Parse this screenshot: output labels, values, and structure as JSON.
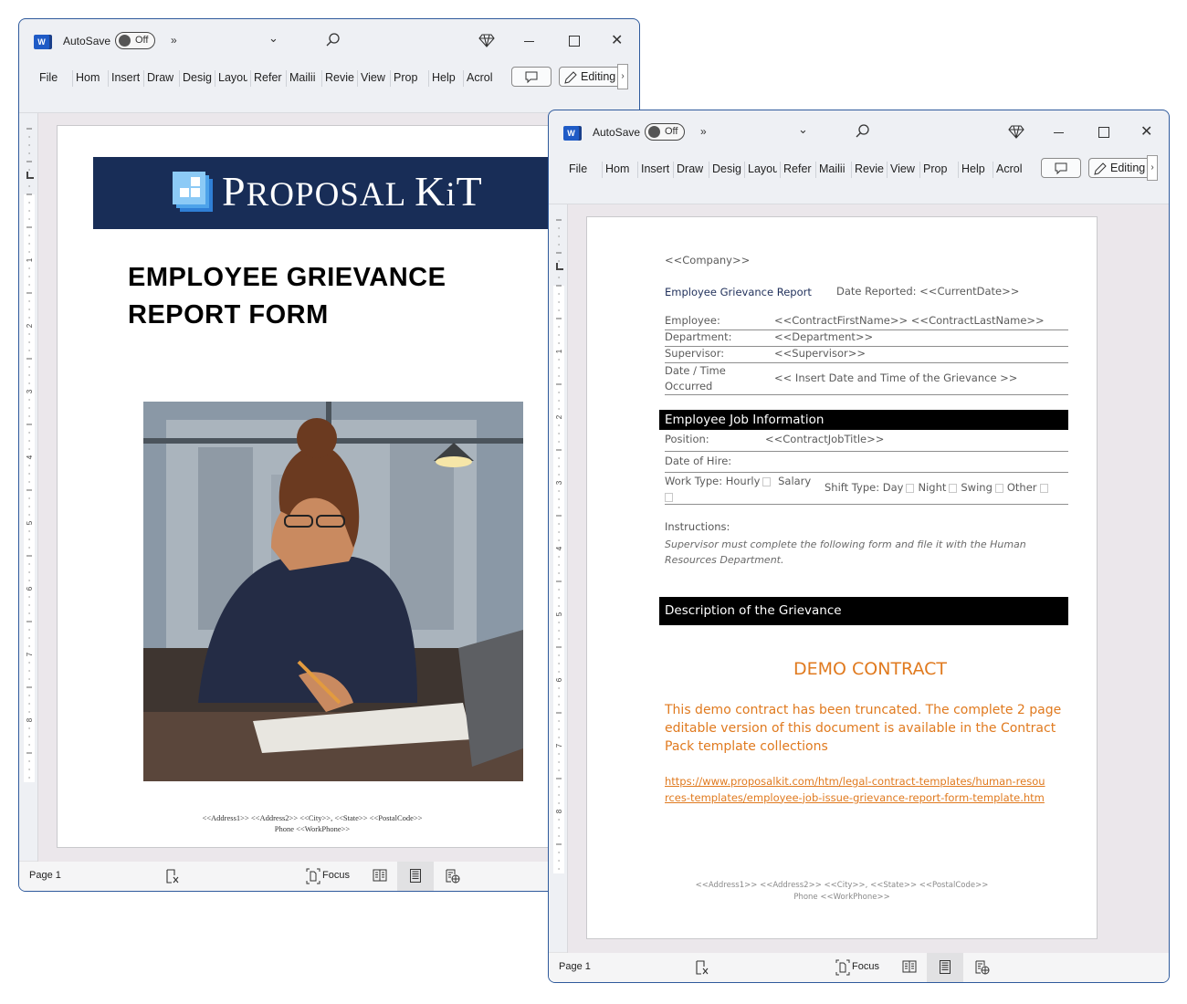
{
  "app": {
    "autosave_label": "AutoSave",
    "autosave_state": "Off",
    "more_glyph": "»",
    "ribbon_tabs": [
      "File",
      "Hom",
      "Insert",
      "Draw",
      "Desig",
      "Layou",
      "Refer",
      "Mailii",
      "Revie",
      "View",
      "Prop",
      "Help",
      "Acrol"
    ],
    "editing_label": "Editing",
    "status_page": "Page 1",
    "focus_label": "Focus",
    "ruler_numbers": [
      "1",
      "2",
      "3",
      "4",
      "5"
    ],
    "vruler_numbers": [
      "1",
      "2",
      "3",
      "4",
      "5",
      "6",
      "7",
      "8"
    ]
  },
  "cover": {
    "logo_text_parts": [
      "P",
      "ROPOSAL ",
      "K",
      "i",
      "T"
    ],
    "title_line1": "EMPLOYEE GRIEVANCE",
    "title_line2": "REPORT FORM",
    "photo_alt": "Illustration of a stressed woman reviewing documents at a desk",
    "footer_line1": "<<Address1>> <<Address2>> <<City>>, <<State>> <<PostalCode>>",
    "footer_line2": "Phone <<WorkPhone>>"
  },
  "form": {
    "company": "<<Company>>",
    "report_title": "Employee Grievance Report",
    "date_reported": "Date Reported: <<CurrentDate>>",
    "fields": [
      {
        "label": "Employee:",
        "value": "<<ContractFirstName>> <<ContractLastName>>"
      },
      {
        "label": "Department:",
        "value": "<<Department>>"
      },
      {
        "label": "Supervisor:",
        "value": "<<Supervisor>>"
      },
      {
        "label": "Date / Time Occurred",
        "value": "<< Insert Date and Time of the Grievance >>"
      }
    ],
    "job_section_title": "Employee Job Information",
    "position_label": "Position:",
    "position_value": "<<ContractJobTitle>>",
    "hire_label": "Date of Hire:",
    "work_type_label": "Work Type:",
    "work_type_options": [
      "Hourly",
      "Salary"
    ],
    "shift_type_label": "Shift Type:",
    "shift_type_options": [
      "Day",
      "Night",
      "Swing",
      "Other"
    ],
    "instructions_label": "Instructions:",
    "instructions_text": "Supervisor must complete the following form and file it with the Human Resources Department.",
    "grievance_section_title": "Description of the Grievance",
    "demo_title": "DEMO CONTRACT",
    "demo_text": "This demo contract has been truncated. The complete 2 page editable version of this document is available in the Contract Pack template collections",
    "demo_link": "https://www.proposalkit.com/htm/legal-contract-templates/human-resources-templates/employee-job-issue-grievance-report-form-template.htm",
    "footer_line1": "<<Address1>> <<Address2>> <<City>>, <<State>> <<PostalCode>>",
    "footer_line2": "Phone <<WorkPhone>>"
  },
  "colors": {
    "banner": "#182d57",
    "demo_orange": "#e07a1f",
    "window_border": "#2f5a9c",
    "report_title": "#1f2f5a"
  }
}
